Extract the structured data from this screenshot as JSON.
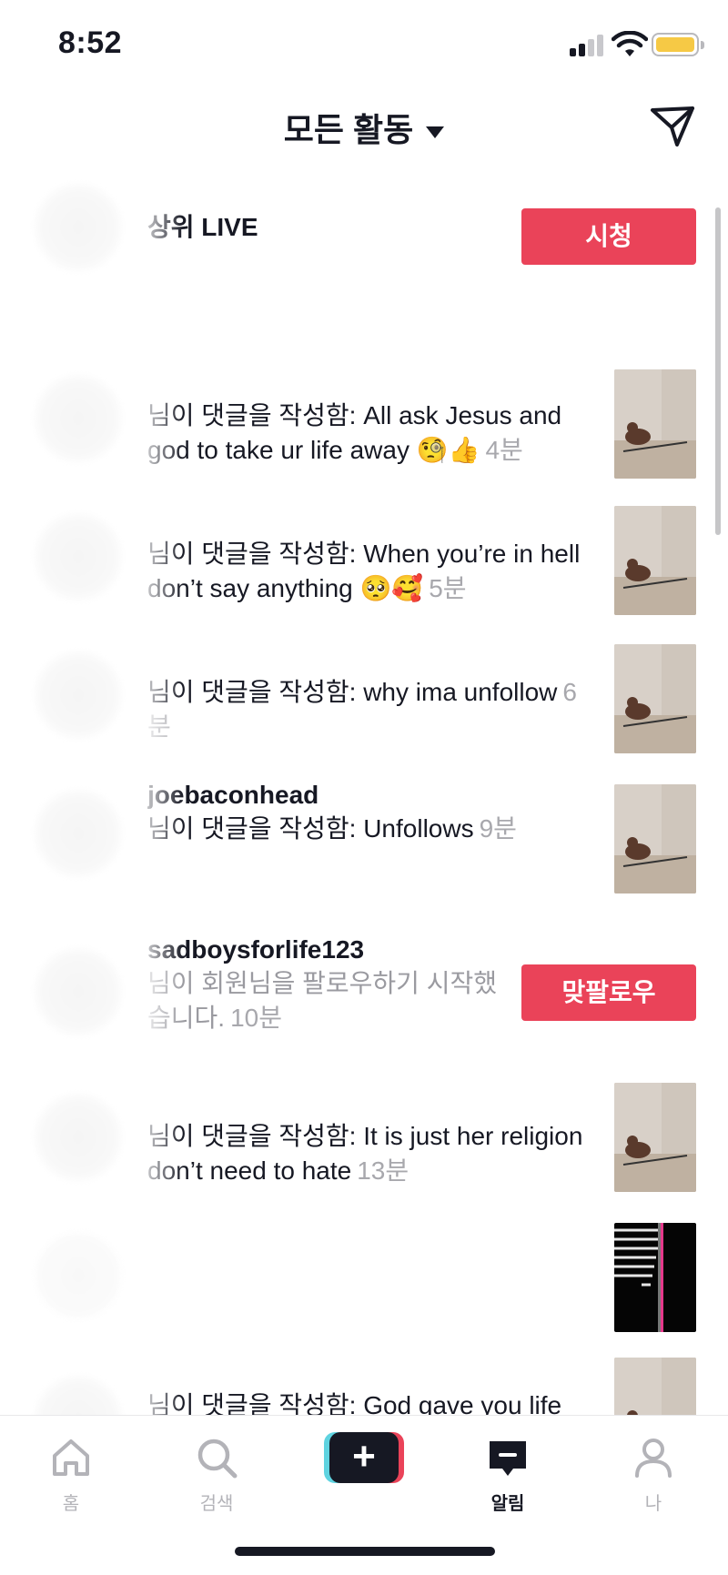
{
  "status_bar": {
    "time": "8:52"
  },
  "header": {
    "title": "모든 활동"
  },
  "top_live": {
    "label": "상위 LIVE",
    "button": "시청"
  },
  "notifications": [
    {
      "username": "",
      "message": "님이 댓글을 작성함: All ask Jesus and god to take ur life away 🧐👍",
      "time": "4분",
      "thumb": "dog"
    },
    {
      "username": "",
      "message": "님이 댓글을 작성함: When you’re in hell don’t say anything 🥺🥰",
      "time": "5분",
      "thumb": "dog"
    },
    {
      "username": "",
      "message": "님이 댓글을 작성함: why ima unfollow",
      "time": "6분",
      "thumb": "dog"
    },
    {
      "username": "joebaconhead",
      "message": "님이 댓글을 작성함: Unfollows",
      "time": "9분",
      "thumb": "dog"
    },
    {
      "username": "sadboysforlife123",
      "message": "님이 회원님을 팔로우하기 시작했습니다.",
      "time": "10분",
      "button": "맞팔로우"
    },
    {
      "username": "",
      "message": "님이 댓글을 작성함: It is just her religion don’t need to hate",
      "time": "13분",
      "thumb": "dog"
    },
    {
      "username": "",
      "message": "",
      "time": "",
      "thumb": "stairs"
    },
    {
      "username": "",
      "message": "님이 댓글을 작성함: God gave you life",
      "time": "",
      "thumb": "dog"
    }
  ],
  "tabs": [
    {
      "label": "홈",
      "icon": "home-icon",
      "active": false
    },
    {
      "label": "검색",
      "icon": "search-icon",
      "active": false
    },
    {
      "label": "",
      "icon": "create-icon",
      "active": false
    },
    {
      "label": "알림",
      "icon": "inbox-icon",
      "active": true
    },
    {
      "label": "나",
      "icon": "profile-icon",
      "active": false
    }
  ],
  "colors": {
    "accent": "#ea4359",
    "text": "#161823",
    "muted": "#a8a8ad"
  }
}
